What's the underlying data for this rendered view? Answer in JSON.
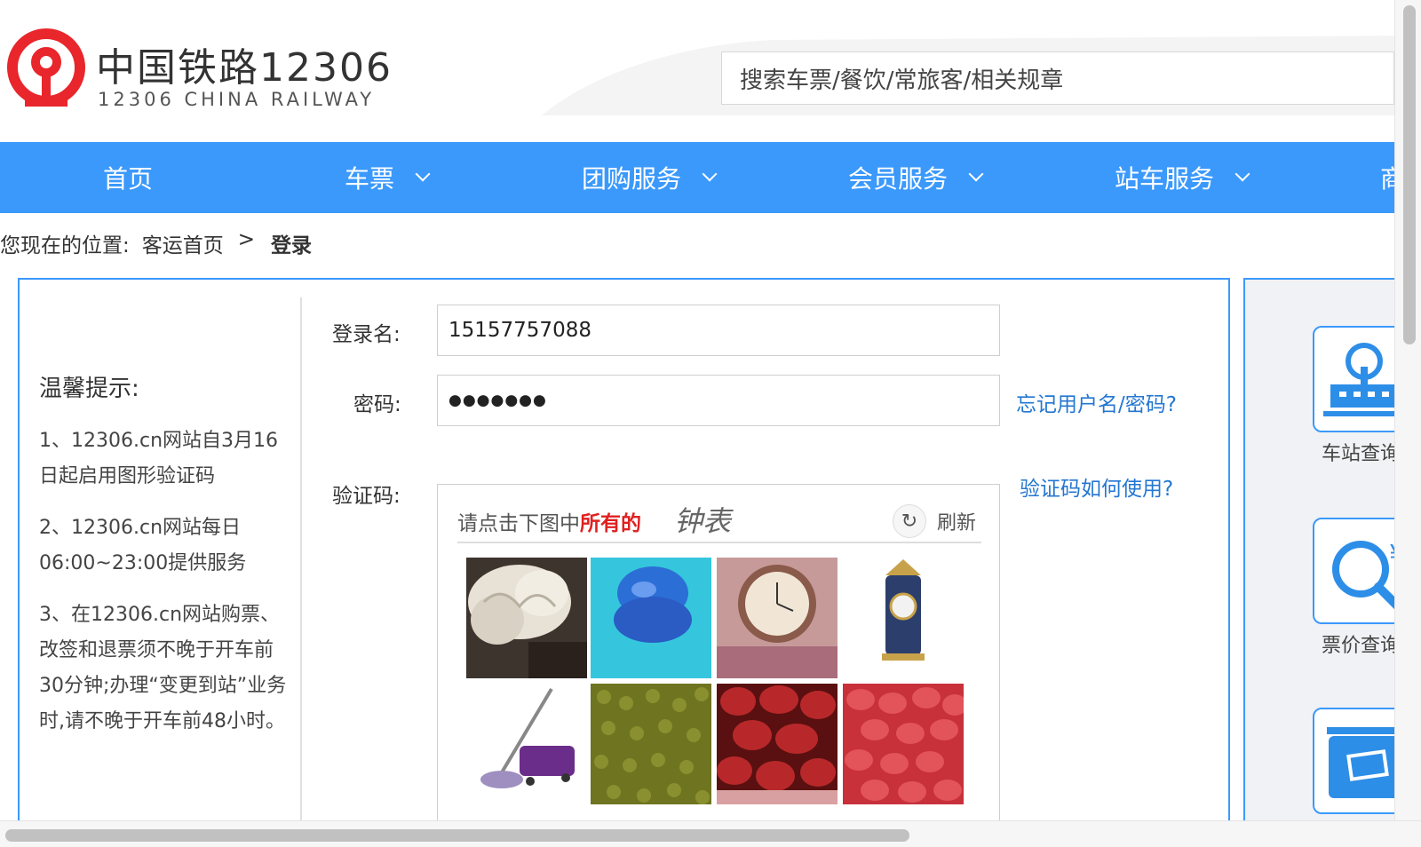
{
  "header": {
    "brand_cn": "中国铁路12306",
    "brand_en": "12306 CHINA RAILWAY",
    "search_placeholder": "搜索车票/餐饮/常旅客/相关规章",
    "logo_icon": "china-railway-logo-icon",
    "logo_color": "#e8262b"
  },
  "nav": {
    "bg_color": "#3b99fc",
    "items": [
      {
        "label": "首页"
      },
      {
        "label": "车票"
      },
      {
        "label": "团购服务"
      },
      {
        "label": "会员服务"
      },
      {
        "label": "站车服务"
      },
      {
        "label": "商"
      }
    ]
  },
  "breadcrumb": {
    "prefix": "您现在的位置:",
    "home": "客运首页",
    "separator": ">",
    "current": "登录"
  },
  "tips": {
    "title": "温馨提示:",
    "items": [
      "1、12306.cn网站自3月16日起启用图形验证码",
      "2、12306.cn网站每日06:00~23:00提供服务",
      "3、在12306.cn网站购票、改签和退票须不晚于开车前30分钟;办理“变更到站”业务时,请不晚于开车前48小时。"
    ]
  },
  "login": {
    "username_label": "登录名:",
    "username_value": "15157757088",
    "password_label": "密码:",
    "password_value": "●●●●●●●",
    "forgot_link": "忘记用户名/密码?",
    "captcha_label": "验证码:",
    "captcha_help_link": "验证码如何使用?"
  },
  "captcha": {
    "prompt_prefix": "请点击下图中",
    "prompt_highlight": "所有的",
    "target_word": "钟表",
    "refresh_label": "刷新",
    "refresh_icon": "refresh-icon",
    "tiles": [
      {
        "name": "captcha-tile-white-fungus"
      },
      {
        "name": "captcha-tile-blue-funnel"
      },
      {
        "name": "captcha-tile-pocket-watch"
      },
      {
        "name": "captcha-tile-ornate-clock"
      },
      {
        "name": "captcha-tile-mop"
      },
      {
        "name": "captcha-tile-mung-beans"
      },
      {
        "name": "captcha-tile-red-dates"
      },
      {
        "name": "captcha-tile-red-dates-pile"
      }
    ]
  },
  "side": {
    "items": [
      {
        "label": "车站查询",
        "icon": "station-icon"
      },
      {
        "label": "票价查询",
        "icon": "fare-search-icon"
      },
      {
        "label": "",
        "icon": "ticket-icon"
      }
    ]
  }
}
